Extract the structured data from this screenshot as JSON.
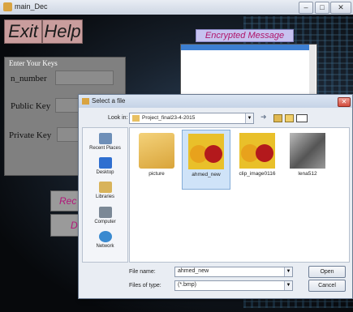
{
  "window": {
    "title": "main_Dec"
  },
  "menu": {
    "exit_label": "Exit",
    "help_label": "Help"
  },
  "keys_panel": {
    "legend": "Enter Your Keys",
    "n_number_label": "n_number",
    "public_key_label": "Public Key",
    "private_key_label": "Private Key"
  },
  "encrypted": {
    "label": "Encrypted Message"
  },
  "left_buttons": {
    "top_partial": "Rec",
    "bottom_partial": "D"
  },
  "dialog": {
    "title": "Select a file",
    "look_in_label": "Look in:",
    "look_in_value": "Project_final23-4-2015",
    "places": [
      "Recent Places",
      "Desktop",
      "Libraries",
      "Computer",
      "Network"
    ],
    "files": [
      {
        "name": "picture",
        "kind": "folder"
      },
      {
        "name": "ahmed_new",
        "kind": "image",
        "selected": true
      },
      {
        "name": "clip_image0116",
        "kind": "image"
      },
      {
        "name": "lena512",
        "kind": "image"
      }
    ],
    "file_name_label": "File name:",
    "file_name_value": "ahmed_new",
    "files_of_type_label": "Files of type:",
    "files_of_type_value": "(*.bmp)",
    "open_label": "Open",
    "cancel_label": "Cancel"
  },
  "colors": {
    "menu_button": "#c99d9d",
    "encrypted_text": "#b0156a",
    "selection": "#cfe3f8"
  }
}
